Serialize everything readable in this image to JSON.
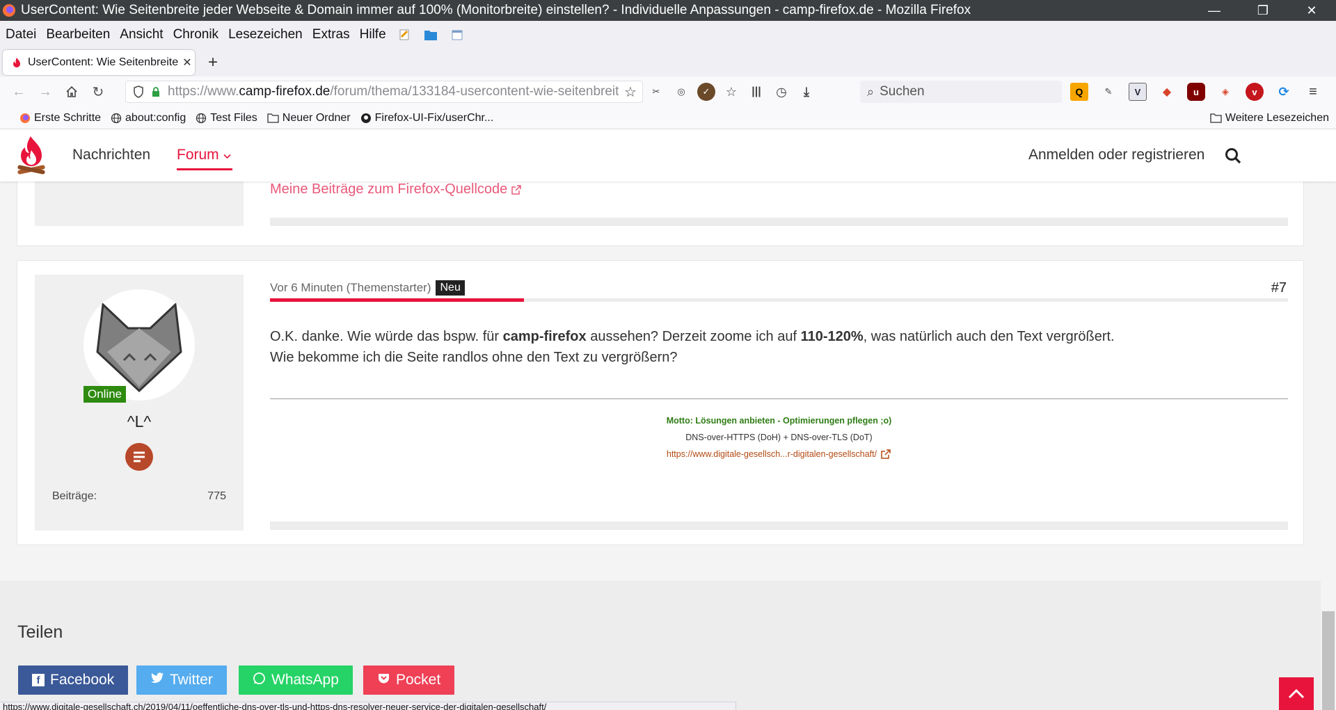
{
  "window": {
    "title": "UserContent: Wie Seitenbreite jeder Webseite & Domain immer auf 100% (Monitorbreite) einstellen? - Individuelle Anpassungen - camp-firefox.de - Mozilla Firefox"
  },
  "menu": [
    "Datei",
    "Bearbeiten",
    "Ansicht",
    "Chronik",
    "Lesezeichen",
    "Extras",
    "Hilfe"
  ],
  "tab": {
    "title": "UserContent: Wie Seitenbreite jeder Webseite"
  },
  "urlbar": {
    "prefix": "https://www.",
    "domain": "camp-firefox.de",
    "path": "/forum/thema/133184-usercontent-wie-seitenbreite"
  },
  "search": {
    "placeholder": "Suchen"
  },
  "bookmarks": [
    "Erste Schritte",
    "about:config",
    "Test Files",
    "Neuer Ordner",
    "Firefox-UI-Fix/userChr...",
    "Weitere Lesezeichen"
  ],
  "site": {
    "nav": {
      "news": "Nachrichten",
      "forum": "Forum",
      "login": "Anmelden oder registrieren"
    },
    "prev_post_link": "Meine Beiträge zum Firefox-Quellcode",
    "post": {
      "time": "Vor 6 Minuten (Themenstarter)",
      "badge": "Neu",
      "number": "#7",
      "line1_a": "O.K. danke. Wie würde das bspw. für ",
      "line1_b": "camp-firefox",
      "line1_c": " aussehen? Derzeit zoome ich auf ",
      "line1_d": "110-120%",
      "line1_e": ", was natürlich auch den Text vergrößert.",
      "line2": "Wie bekomme ich die Seite randlos ohne den Text zu vergrößern?",
      "sig_motto": "Motto: Lösungen anbieten - Optimierungen pflegen ;o)",
      "sig_dns": "DNS-over-HTTPS (DoH) + DNS-over-TLS (DoT)",
      "sig_link": "https://www.digitale-gesellsch...r-digitalen-gesellschaft/"
    },
    "author": {
      "online": "Online",
      "name": "^L^",
      "posts_label": "Beiträge:",
      "posts_value": "775"
    },
    "share": {
      "heading": "Teilen",
      "facebook": "Facebook",
      "twitter": "Twitter",
      "whatsapp": "WhatsApp",
      "pocket": "Pocket"
    }
  },
  "statusbar": {
    "text": "https://www.digitale-gesellschaft.ch/2019/04/11/oeffentliche-dns-over-tls-und-https-dns-resolver-neuer-service-der-digitalen-gesellschaft/"
  },
  "colors": {
    "accent": "#e8143c",
    "online": "#2e8b10",
    "facebook": "#3b5998",
    "twitter": "#55acee",
    "whatsapp": "#25d366",
    "pocket": "#ef4056",
    "sig_link": "#b24a12",
    "motto": "#2f7d15"
  }
}
